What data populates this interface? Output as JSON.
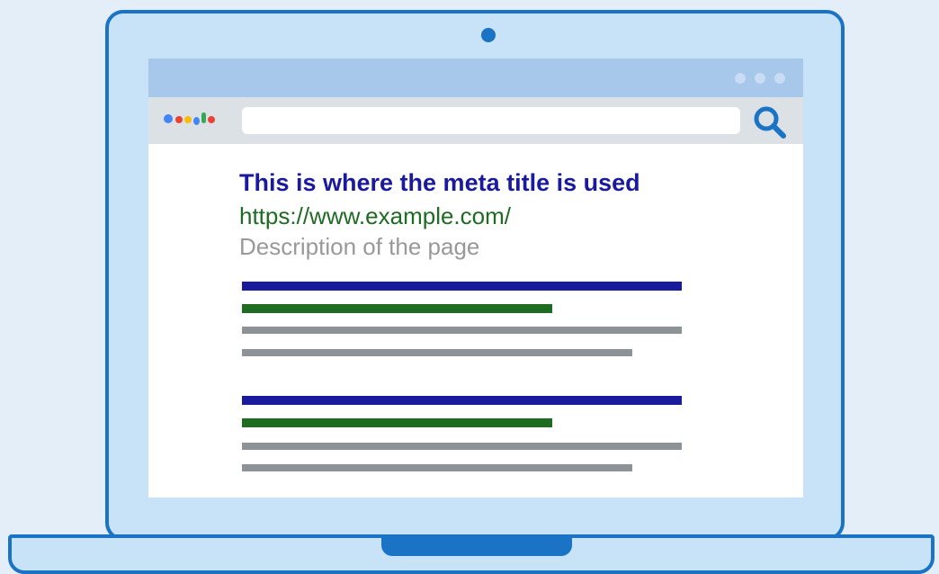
{
  "result": {
    "title": "This is where the meta title is used",
    "url": "https://www.example.com/",
    "description": "Description of the page"
  },
  "colors": {
    "title_blue": "#1a1a9c",
    "url_green": "#1e6b22",
    "description_gray": "#999999",
    "frame_blue": "#1a73c4",
    "logo_blue": "#4285f4",
    "logo_red": "#ea4335",
    "logo_yellow": "#fbbc05",
    "logo_green": "#34a853"
  },
  "icons": [
    "camera-icon",
    "window-controls-icon",
    "search-engine-logo-icon",
    "search-icon"
  ]
}
